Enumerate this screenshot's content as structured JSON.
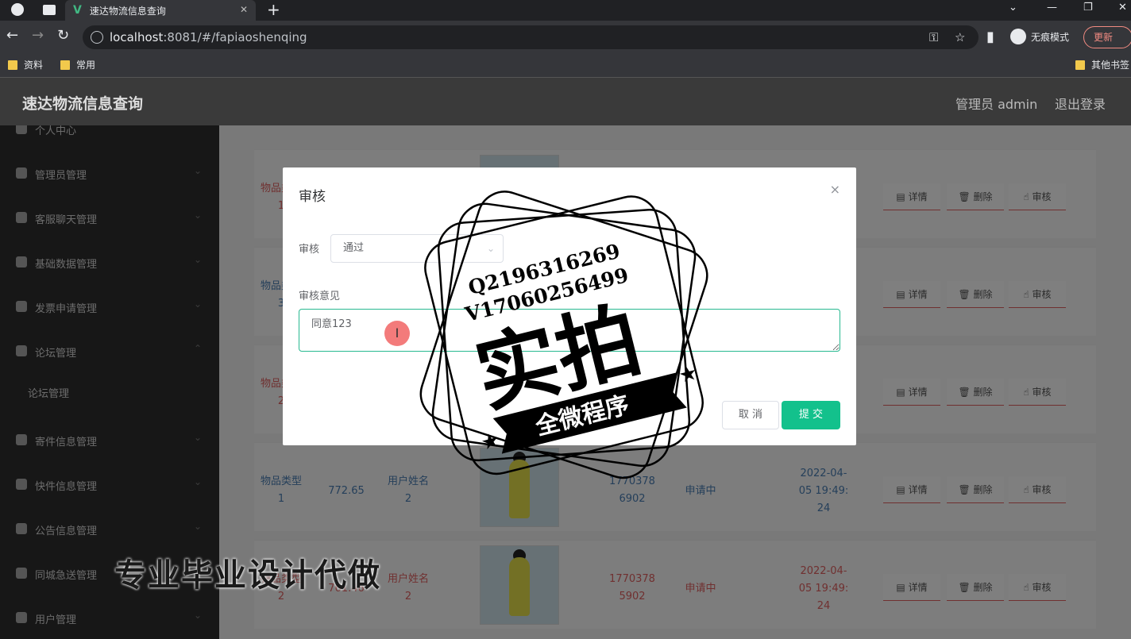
{
  "browser": {
    "tab_title": "速达物流信息查询",
    "tab_close": "✕",
    "new_tab": "+",
    "url_host": "localhost",
    "url_rest": ":8081/#/fapiaoshenqing",
    "incognito_label": "无痕模式",
    "update_label": "更新",
    "bookmarks": [
      "资料",
      "常用"
    ],
    "other_bookmarks": "其他书签"
  },
  "header": {
    "app_title": "速达物流信息查询",
    "user": "管理员 admin",
    "logout": "退出登录"
  },
  "sidebar": {
    "items": [
      {
        "label": "个人中心"
      },
      {
        "label": "管理员管理"
      },
      {
        "label": "客服聊天管理"
      },
      {
        "label": "基础数据管理"
      },
      {
        "label": "发票申请管理"
      },
      {
        "label": "论坛管理"
      },
      {
        "label": "寄件信息管理"
      },
      {
        "label": "快件信息管理"
      },
      {
        "label": "公告信息管理"
      },
      {
        "label": "同城急送管理"
      },
      {
        "label": "用户管理"
      }
    ],
    "sub_item": "论坛管理"
  },
  "table": {
    "actions": {
      "detail": "详情",
      "delete": "删除",
      "review": "审核"
    },
    "rows": [
      {
        "type": "物品类型",
        "num": "1",
        "amount": "",
        "user": "",
        "user_num": "",
        "phone": "",
        "status": "",
        "time": ""
      },
      {
        "type": "物品类型",
        "num": "3",
        "amount": "",
        "user": "",
        "user_num": "",
        "phone": "",
        "status": "",
        "time": ""
      },
      {
        "type": "物品类型",
        "num": "2",
        "amount": "",
        "user": "",
        "user_num": "",
        "phone": "",
        "status": "",
        "time": ""
      },
      {
        "type": "物品类型",
        "num": "1",
        "amount": "772.65",
        "user": "用户姓名",
        "user_num": "2",
        "phone": "17703786902",
        "status": "申请中",
        "time": "2022-04-05 19:49:24"
      },
      {
        "type": "物品类型",
        "num": "2",
        "amount": "761.46",
        "user": "用户姓名",
        "user_num": "2",
        "phone": "17703785902",
        "status": "申请中",
        "time": "2022-04-05 19:49:24"
      }
    ]
  },
  "dialog": {
    "title": "审核",
    "close": "×",
    "field1_label": "审核",
    "field1_value": "通过",
    "field2_label": "审核意见",
    "field2_value": "同意123",
    "cancel": "取 消",
    "submit": "提 交"
  },
  "watermark": {
    "line1": "Q2196316269",
    "line2": "V17060256499",
    "big": "实拍",
    "banner": "全微程序",
    "bottom": "专业毕业设计代做"
  }
}
